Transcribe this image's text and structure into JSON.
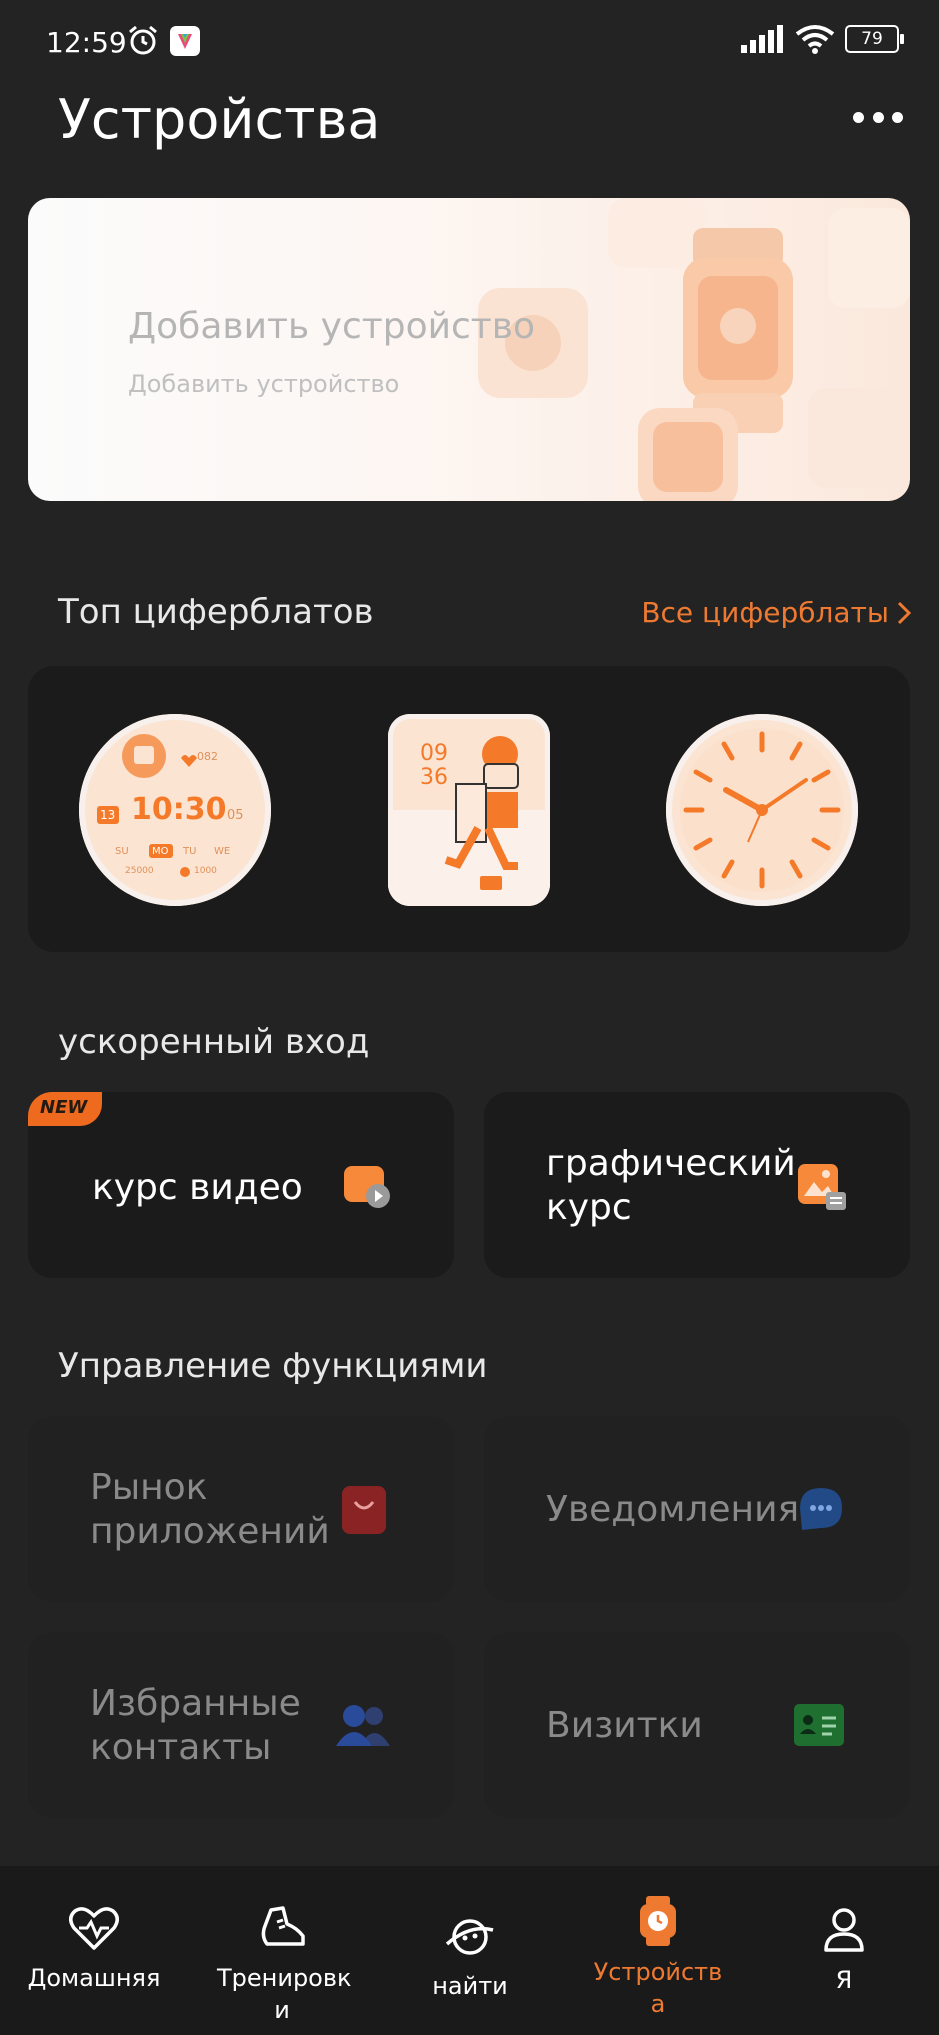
{
  "status": {
    "time": "12:59",
    "battery": "79"
  },
  "header": {
    "title": "Устройства"
  },
  "banner": {
    "title": "Добавить устройство",
    "subtitle": "Добавить устройство"
  },
  "watch_faces": {
    "title": "Топ циферблатов",
    "all_link": "Все циферблаты",
    "face1": {
      "hour_min": "10:30",
      "day": "13",
      "month_day": "05",
      "hr": "082",
      "steps": "25000",
      "kcal": "1000",
      "days": [
        "SU",
        "MO",
        "TU",
        "WE"
      ]
    },
    "face2": {
      "time_top": "09",
      "time_bottom": "36"
    }
  },
  "quick_entry": {
    "title": "ускоренный вход",
    "badge": "NEW",
    "items": [
      {
        "label": "курс видео"
      },
      {
        "label": "графический курс"
      }
    ]
  },
  "functions": {
    "title": "Управление функциями",
    "items": [
      {
        "label": "Рынок приложений"
      },
      {
        "label": "Уведомления"
      },
      {
        "label": "Избранные контакты"
      },
      {
        "label": "Визитки"
      }
    ]
  },
  "bottom_nav": {
    "items": [
      {
        "label": "Домашняя"
      },
      {
        "label": "Тренировк и"
      },
      {
        "label": "найти"
      },
      {
        "label": "Устройств а"
      },
      {
        "label": "Я"
      }
    ],
    "active_color": "#ee7a32"
  }
}
